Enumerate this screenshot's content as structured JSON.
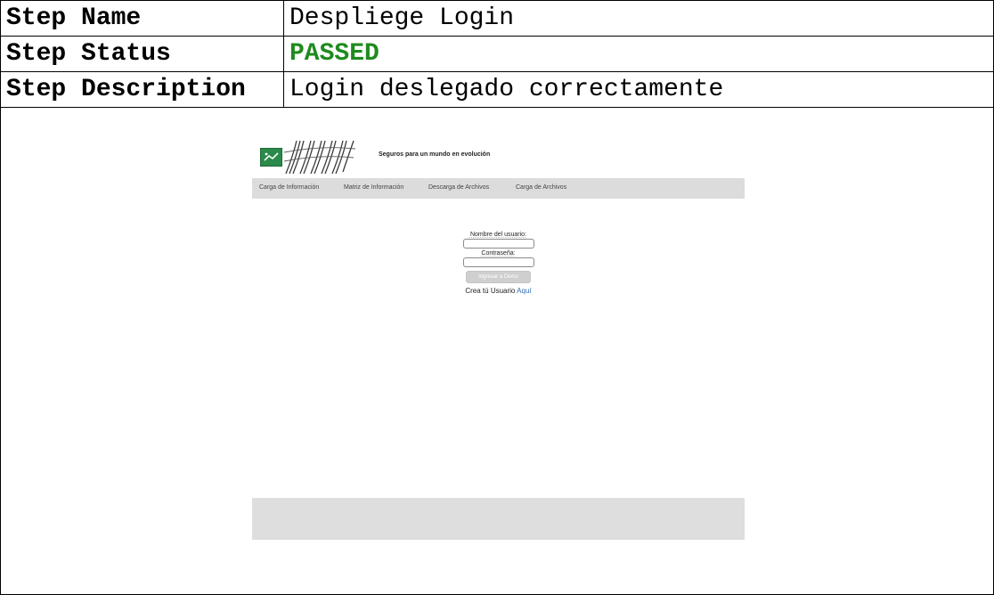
{
  "steps": [
    {
      "label": "Step Name",
      "value": "Despliege Login"
    },
    {
      "label": "Step Status",
      "value": "PASSED"
    },
    {
      "label": "Step Description",
      "value": "Login deslegado correctamente"
    }
  ],
  "colors": {
    "status_passed": "#1e8b1e",
    "nav_background": "#dcdcdc",
    "footer_background": "#dedede",
    "bank_logo_green": "#2a8a4a",
    "link": "#2f6fb0"
  },
  "screenshot": {
    "tagline": "Seguros para un mundo en evolución",
    "nav": [
      "Carga de Información",
      "Matriz de Información",
      "Descarga de Archivos",
      "Carga de Archivos"
    ],
    "login": {
      "username_label": "Nombre del usuario:",
      "username_value": "",
      "password_label": "Contraseña:",
      "password_value": "",
      "submit_label": "Ingresar a Demo",
      "create_text": "Crea tú Usuario",
      "create_link": "Aquí"
    },
    "icons": {
      "bank_logo": "bank-logo-icon",
      "brand_logo": "brand-logo-icon"
    }
  }
}
